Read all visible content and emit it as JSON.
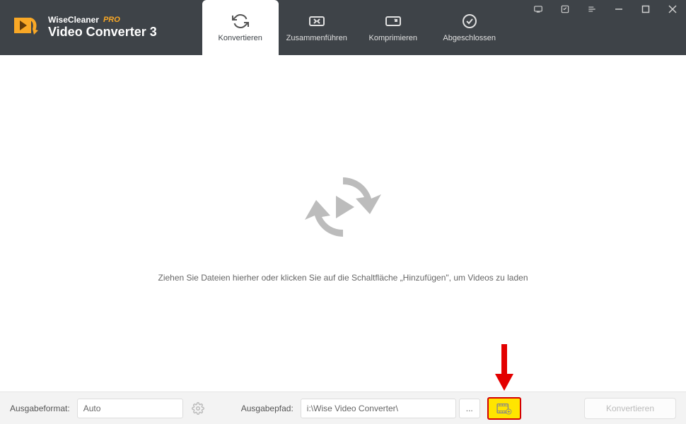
{
  "brand": {
    "vendor": "WiseCleaner",
    "pro": "PRO",
    "product": "Video Converter 3"
  },
  "tabs": {
    "convert": "Konvertieren",
    "merge": "Zusammenführen",
    "compress": "Komprimieren",
    "done": "Abgeschlossen"
  },
  "dropzone": {
    "text": "Ziehen Sie Dateien hierher oder klicken Sie auf die Schaltfläche „Hinzufügen\", um Videos zu laden"
  },
  "bottom": {
    "format_label": "Ausgabeformat:",
    "format_value": "Auto",
    "path_label": "Ausgabepfad:",
    "path_value": "i:\\Wise Video Converter\\",
    "browse": "...",
    "convert_button": "Konvertieren"
  }
}
